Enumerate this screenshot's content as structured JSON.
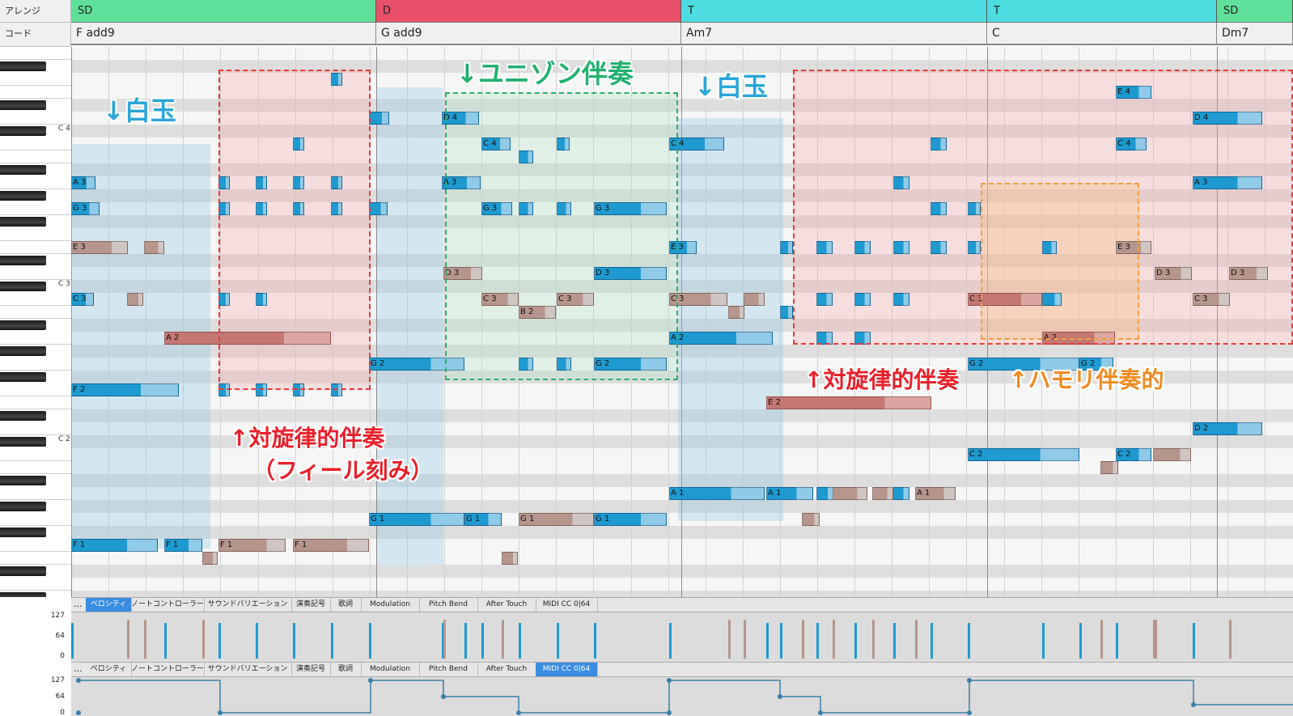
{
  "header": {
    "arrange_label": "アレンジ",
    "chord_label": "コード",
    "sections": [
      {
        "label": "SD",
        "color": "#5fe09a"
      },
      {
        "label": "D",
        "color": "#e8506a"
      },
      {
        "label": "T",
        "color": "#4ddde0"
      },
      {
        "label": "T",
        "color": "#4ddde0"
      },
      {
        "label": "SD",
        "color": "#5fe09a"
      }
    ],
    "chords": [
      "F add9",
      "G add9",
      "Am7",
      "C",
      "Dm7"
    ]
  },
  "keyboard": {
    "octave_labels": [
      "C 4",
      "C 3",
      "C 2"
    ]
  },
  "annotations": [
    {
      "text": "↓白玉",
      "color": "#2aa6d8"
    },
    {
      "text": "↓ユニゾン伴奏",
      "color": "#22b070"
    },
    {
      "text": "↓白玉",
      "color": "#2aa6d8"
    },
    {
      "text": "↑対旋律的伴奏",
      "color": "#e8202a"
    },
    {
      "text": "（フィール刻み）",
      "color": "#e8202a"
    },
    {
      "text": "↑対旋律的伴奏",
      "color": "#e8202a"
    },
    {
      "text": "↑ハモリ伴奏的",
      "color": "#f08a20"
    }
  ],
  "notes": [
    {
      "label": "A 3",
      "pitch": "A3",
      "start": 0,
      "len": 30,
      "color": "blue"
    },
    {
      "label": "G 3",
      "pitch": "G3",
      "start": 0,
      "len": 35,
      "color": "blue"
    },
    {
      "label": "E 3",
      "pitch": "E3",
      "start": 0,
      "len": 70,
      "color": "brown"
    },
    {
      "label": "",
      "pitch": "E3",
      "start": 90,
      "len": 25,
      "color": "brown"
    },
    {
      "label": "C 3",
      "pitch": "C3",
      "start": 0,
      "len": 28,
      "color": "blue"
    },
    {
      "label": "",
      "pitch": "C3",
      "start": 69,
      "len": 20,
      "color": "brown"
    },
    {
      "label": "F 2",
      "pitch": "F2",
      "start": 0,
      "len": 133,
      "color": "blue"
    },
    {
      "label": "F 1",
      "pitch": "F1",
      "start": 0,
      "len": 107,
      "color": "blue"
    },
    {
      "label": "F 1",
      "pitch": "F1",
      "start": 115,
      "len": 47,
      "color": "blue"
    },
    {
      "label": "",
      "pitch": "E1",
      "start": 162,
      "len": 19,
      "color": "brown"
    },
    {
      "label": "A 2",
      "pitch": "A2",
      "start": 115,
      "len": 206,
      "color": "red"
    },
    {
      "label": "",
      "pitch": "F4",
      "start": 321,
      "len": 14,
      "color": "blue"
    },
    {
      "label": "",
      "pitch": "C4",
      "start": 274,
      "len": 14,
      "color": "blue"
    },
    {
      "label": "",
      "pitch": "A3",
      "start": 182,
      "len": 14,
      "color": "blue"
    },
    {
      "label": "",
      "pitch": "A3",
      "start": 228,
      "len": 14,
      "color": "blue"
    },
    {
      "label": "",
      "pitch": "A3",
      "start": 274,
      "len": 14,
      "color": "blue"
    },
    {
      "label": "",
      "pitch": "A3",
      "start": 321,
      "len": 14,
      "color": "blue"
    },
    {
      "label": "",
      "pitch": "G3",
      "start": 182,
      "len": 14,
      "color": "blue"
    },
    {
      "label": "",
      "pitch": "G3",
      "start": 228,
      "len": 14,
      "color": "blue"
    },
    {
      "label": "",
      "pitch": "G3",
      "start": 274,
      "len": 14,
      "color": "blue"
    },
    {
      "label": "",
      "pitch": "G3",
      "start": 321,
      "len": 14,
      "color": "blue"
    },
    {
      "label": "",
      "pitch": "C3",
      "start": 182,
      "len": 14,
      "color": "blue"
    },
    {
      "label": "",
      "pitch": "C3",
      "start": 228,
      "len": 14,
      "color": "blue"
    },
    {
      "label": "",
      "pitch": "F2",
      "start": 182,
      "len": 14,
      "color": "blue"
    },
    {
      "label": "",
      "pitch": "F2",
      "start": 228,
      "len": 14,
      "color": "blue"
    },
    {
      "label": "",
      "pitch": "F2",
      "start": 274,
      "len": 14,
      "color": "blue"
    },
    {
      "label": "",
      "pitch": "F2",
      "start": 321,
      "len": 14,
      "color": "blue"
    },
    {
      "label": "F 1",
      "pitch": "F1",
      "start": 182,
      "len": 83,
      "color": "brown"
    },
    {
      "label": "F 1",
      "pitch": "F1",
      "start": 274,
      "len": 94,
      "color": "brown"
    },
    {
      "label": "",
      "pitch": "E1",
      "start": 532,
      "len": 20,
      "color": "brown"
    },
    {
      "label": "",
      "pitch": "D4",
      "start": 368,
      "len": 25,
      "color": "blue"
    },
    {
      "label": "",
      "pitch": "G3",
      "start": 368,
      "len": 23,
      "color": "blue"
    },
    {
      "label": "G 2",
      "pitch": "G2",
      "start": 368,
      "len": 118,
      "color": "blue"
    },
    {
      "label": "G 1",
      "pitch": "G1",
      "start": 368,
      "len": 118,
      "color": "blue"
    },
    {
      "label": "G 1",
      "pitch": "G1",
      "start": 486,
      "len": 46,
      "color": "blue"
    },
    {
      "label": "D 4",
      "pitch": "D4",
      "start": 458,
      "len": 46,
      "color": "blue"
    },
    {
      "label": "C 4",
      "pitch": "C4",
      "start": 507,
      "len": 36,
      "color": "blue"
    },
    {
      "label": "",
      "pitch": "B3",
      "start": 553,
      "len": 18,
      "color": "blue"
    },
    {
      "label": "",
      "pitch": "C4",
      "start": 600,
      "len": 16,
      "color": "blue"
    },
    {
      "label": "A 3",
      "pitch": "A3",
      "start": 458,
      "len": 48,
      "color": "blue"
    },
    {
      "label": "G 3",
      "pitch": "G3",
      "start": 507,
      "len": 38,
      "color": "blue"
    },
    {
      "label": "",
      "pitch": "G3",
      "start": 553,
      "len": 18,
      "color": "blue"
    },
    {
      "label": "",
      "pitch": "G3",
      "start": 600,
      "len": 18,
      "color": "blue"
    },
    {
      "label": "G 3",
      "pitch": "G3",
      "start": 646,
      "len": 90,
      "color": "blue"
    },
    {
      "label": "D 3",
      "pitch": "D3",
      "start": 460,
      "len": 48,
      "color": "brown"
    },
    {
      "label": "D 3",
      "pitch": "D3",
      "start": 646,
      "len": 90,
      "color": "blue"
    },
    {
      "label": "C 3",
      "pitch": "C3",
      "start": 507,
      "len": 46,
      "color": "brown"
    },
    {
      "label": "C 3",
      "pitch": "C3",
      "start": 600,
      "len": 46,
      "color": "brown"
    },
    {
      "label": "B 2",
      "pitch": "B2",
      "start": 553,
      "len": 46,
      "color": "brown"
    },
    {
      "label": "",
      "pitch": "G2",
      "start": 553,
      "len": 18,
      "color": "blue"
    },
    {
      "label": "",
      "pitch": "G2",
      "start": 600,
      "len": 18,
      "color": "blue"
    },
    {
      "label": "G 2",
      "pitch": "G2",
      "start": 646,
      "len": 90,
      "color": "blue"
    },
    {
      "label": "G 1",
      "pitch": "G1",
      "start": 553,
      "len": 93,
      "color": "brown"
    },
    {
      "label": "G 1",
      "pitch": "G1",
      "start": 646,
      "len": 90,
      "color": "blue"
    },
    {
      "label": "C 4",
      "pitch": "C4",
      "start": 739,
      "len": 68,
      "color": "blue"
    },
    {
      "label": "E 3",
      "pitch": "E3",
      "start": 739,
      "len": 34,
      "color": "blue"
    },
    {
      "label": "C 3",
      "pitch": "C3",
      "start": 739,
      "len": 72,
      "color": "brown"
    },
    {
      "label": "",
      "pitch": "C3",
      "start": 831,
      "len": 26,
      "color": "brown"
    },
    {
      "label": "",
      "pitch": "B2",
      "start": 812,
      "len": 20,
      "color": "brown"
    },
    {
      "label": "A 2",
      "pitch": "A2",
      "start": 739,
      "len": 128,
      "color": "blue"
    },
    {
      "label": "A 1",
      "pitch": "A1",
      "start": 739,
      "len": 118,
      "color": "blue"
    },
    {
      "label": "A 1",
      "pitch": "A1",
      "start": 859,
      "len": 58,
      "color": "blue"
    },
    {
      "label": "",
      "pitch": "A1",
      "start": 921,
      "len": 22,
      "color": "blue"
    },
    {
      "label": "",
      "pitch": "A1",
      "start": 941,
      "len": 43,
      "color": "brown"
    },
    {
      "label": "",
      "pitch": "A1",
      "start": 990,
      "len": 26,
      "color": "brown"
    },
    {
      "label": "",
      "pitch": "A1",
      "start": 1016,
      "len": 20,
      "color": "blue"
    },
    {
      "label": "A 1",
      "pitch": "A1",
      "start": 1043,
      "len": 50,
      "color": "brown"
    },
    {
      "label": "",
      "pitch": "G1",
      "start": 903,
      "len": 22,
      "color": "brown"
    },
    {
      "label": "E 2",
      "pitch": "E2",
      "start": 859,
      "len": 204,
      "color": "red"
    },
    {
      "label": "",
      "pitch": "C4",
      "start": 1062,
      "len": 20,
      "color": "blue"
    },
    {
      "label": "",
      "pitch": "A3",
      "start": 1016,
      "len": 20,
      "color": "blue"
    },
    {
      "label": "",
      "pitch": "G3",
      "start": 1062,
      "len": 20,
      "color": "blue"
    },
    {
      "label": "",
      "pitch": "E3",
      "start": 876,
      "len": 16,
      "color": "blue"
    },
    {
      "label": "",
      "pitch": "E3",
      "start": 921,
      "len": 20,
      "color": "blue"
    },
    {
      "label": "",
      "pitch": "E3",
      "start": 968,
      "len": 20,
      "color": "blue"
    },
    {
      "label": "",
      "pitch": "E3",
      "start": 1016,
      "len": 20,
      "color": "blue"
    },
    {
      "label": "",
      "pitch": "E3",
      "start": 1062,
      "len": 20,
      "color": "blue"
    },
    {
      "label": "",
      "pitch": "C3",
      "start": 921,
      "len": 20,
      "color": "blue"
    },
    {
      "label": "",
      "pitch": "C3",
      "start": 968,
      "len": 20,
      "color": "blue"
    },
    {
      "label": "",
      "pitch": "C3",
      "start": 1016,
      "len": 20,
      "color": "blue"
    },
    {
      "label": "",
      "pitch": "B2",
      "start": 876,
      "len": 16,
      "color": "blue"
    },
    {
      "label": "",
      "pitch": "A2",
      "start": 921,
      "len": 20,
      "color": "blue"
    },
    {
      "label": "",
      "pitch": "A2",
      "start": 968,
      "len": 20,
      "color": "blue"
    },
    {
      "label": "E 4",
      "pitch": "E4",
      "start": 1291,
      "len": 44,
      "color": "blue"
    },
    {
      "label": "C 4",
      "pitch": "C4",
      "start": 1291,
      "len": 38,
      "color": "blue"
    },
    {
      "label": "",
      "pitch": "G3",
      "start": 1108,
      "len": 16,
      "color": "blue"
    },
    {
      "label": "",
      "pitch": "E3",
      "start": 1108,
      "len": 16,
      "color": "blue"
    },
    {
      "label": "",
      "pitch": "E3",
      "start": 1200,
      "len": 18,
      "color": "blue"
    },
    {
      "label": "E 3",
      "pitch": "E3",
      "start": 1291,
      "len": 44,
      "color": "brown"
    },
    {
      "label": "C 3",
      "pitch": "C3",
      "start": 1108,
      "len": 92,
      "color": "red"
    },
    {
      "label": "",
      "pitch": "C3",
      "start": 1200,
      "len": 24,
      "color": "blue"
    },
    {
      "label": "A 2",
      "pitch": "A2",
      "start": 1200,
      "len": 90,
      "color": "red"
    },
    {
      "label": "G 2",
      "pitch": "G2",
      "start": 1108,
      "len": 138,
      "color": "blue"
    },
    {
      "label": "G 2",
      "pitch": "G2",
      "start": 1246,
      "len": 42,
      "color": "blue"
    },
    {
      "label": "C 2",
      "pitch": "C2",
      "start": 1108,
      "len": 138,
      "color": "blue"
    },
    {
      "label": "C 2",
      "pitch": "C2",
      "start": 1291,
      "len": 44,
      "color": "blue"
    },
    {
      "label": "",
      "pitch": "C2",
      "start": 1337,
      "len": 47,
      "color": "brown"
    },
    {
      "label": "",
      "pitch": "B1",
      "start": 1272,
      "len": 22,
      "color": "brown"
    },
    {
      "label": "D 3",
      "pitch": "D3",
      "start": 1339,
      "len": 46,
      "color": "brown"
    },
    {
      "label": "D 4",
      "pitch": "D4",
      "start": 1386,
      "len": 86,
      "color": "blue"
    },
    {
      "label": "A 3",
      "pitch": "A3",
      "start": 1386,
      "len": 86,
      "color": "blue"
    },
    {
      "label": "D 3",
      "pitch": "D3",
      "start": 1431,
      "len": 48,
      "color": "brown"
    },
    {
      "label": "C 3",
      "pitch": "C3",
      "start": 1386,
      "len": 46,
      "color": "brown"
    },
    {
      "label": "D 2",
      "pitch": "D2",
      "start": 1386,
      "len": 86,
      "color": "blue"
    }
  ],
  "tabs": [
    "ベロシティ",
    "ノートコントローラー",
    "サウンドバリエーション",
    "演奏記号",
    "歌詞",
    "Modulation",
    "Pitch Bend",
    "After Touch",
    "MIDI CC 0|64"
  ],
  "tab_more": "...",
  "velocity_panel": {
    "active_tab": "ベロシティ",
    "y_labels": [
      "127",
      "64",
      "0"
    ]
  },
  "cc_panel": {
    "active_tab": "MIDI CC 0|64",
    "y_labels": [
      "127",
      "64",
      "0"
    ]
  }
}
